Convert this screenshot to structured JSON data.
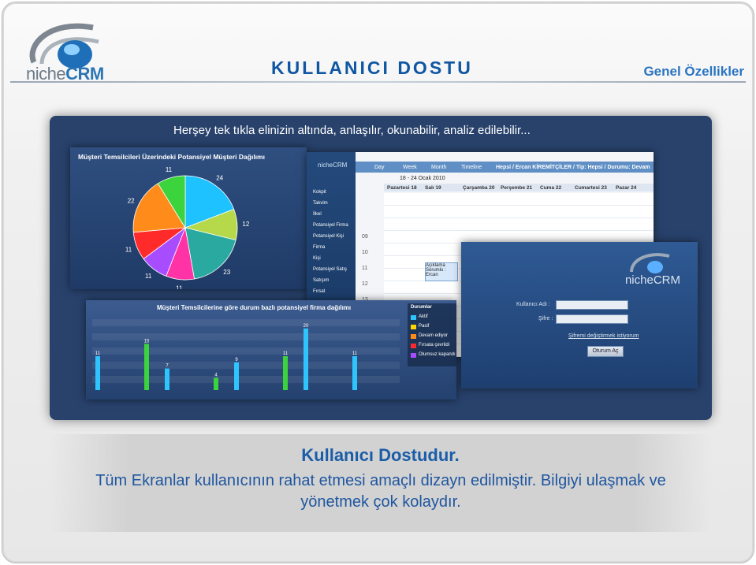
{
  "header": {
    "title": "KULLANICI DOSTU",
    "subtitle": "Genel Özellikler",
    "logo_prefix": "niche",
    "logo_suffix": "CRM"
  },
  "panel": {
    "caption": "Herşey tek tıkla elinizin altında, anlaşılır, okunabilir, analiz edilebilir..."
  },
  "pie_window": {
    "title": "Müşteri Temsilcileri Üzerindeki Potansiyel Müşteri Dağılımı",
    "chart_data": {
      "type": "pie",
      "values": [
        24,
        12,
        23,
        11,
        11,
        11,
        22,
        11
      ],
      "colors": [
        "#1ec2ff",
        "#b5d94a",
        "#2aa9a0",
        "#ff33a6",
        "#a84cff",
        "#ff2b2b",
        "#ff8c1a",
        "#3cd43c"
      ]
    }
  },
  "calendar_window": {
    "logo": "nicheCRM",
    "tabs": [
      "Day",
      "Week",
      "Month",
      "Timeline"
    ],
    "filter": "Hepsi / Ercan KİREMİTÇİLER / Tip: Hepsi / Durumu: Devam",
    "date_range": "18 - 24 Ocak 2010",
    "days": [
      "Pazartesi 18",
      "Salı 19",
      "Çarşamba 20",
      "Perşembe 21",
      "Cuma 22",
      "Cumartesi 23",
      "Pazar 24"
    ],
    "hours": [
      "09",
      "10",
      "11",
      "12",
      "13"
    ],
    "sidebar": [
      "Kokpit",
      "Takvim",
      "İlkel",
      "Potansiyel Firma",
      "Potansiyel Kişi",
      "Firma",
      "Kişi",
      "Potansiyel Satış",
      "Satışım",
      "Fırsat"
    ],
    "event_text": "Açıklama Sorumlu : Ercan"
  },
  "bar_window": {
    "title": "Müşteri Temsilcilerine göre durum bazlı potansiyel firma dağılımı",
    "legend_title": "Durumlar",
    "legend": [
      "Aktif",
      "Pasif",
      "Devam ediyor",
      "Fırsata çevrildi",
      "Olumsuz kapandı"
    ],
    "legend_colors": [
      "#2ec5ff",
      "#ffd400",
      "#ff8c1a",
      "#ff2b2b",
      "#a84cff"
    ],
    "chart_data": {
      "type": "bar",
      "values": [
        11,
        15,
        7,
        4,
        9,
        11,
        20,
        11
      ]
    }
  },
  "login_window": {
    "logo": "nicheCRM",
    "user_label": "Kullanıcı Adı :",
    "pass_label": "Şifre :",
    "forgot": "Şifremi değiştirmek istiyorum",
    "button": "Oturum Aç"
  },
  "bottom": {
    "heading": "Kullanıcı Dostudur.",
    "text": "Tüm Ekranlar kullanıcının rahat etmesi amaçlı dizayn edilmiştir. Bilgiyi ulaşmak ve yönetmek çok kolaydır."
  }
}
